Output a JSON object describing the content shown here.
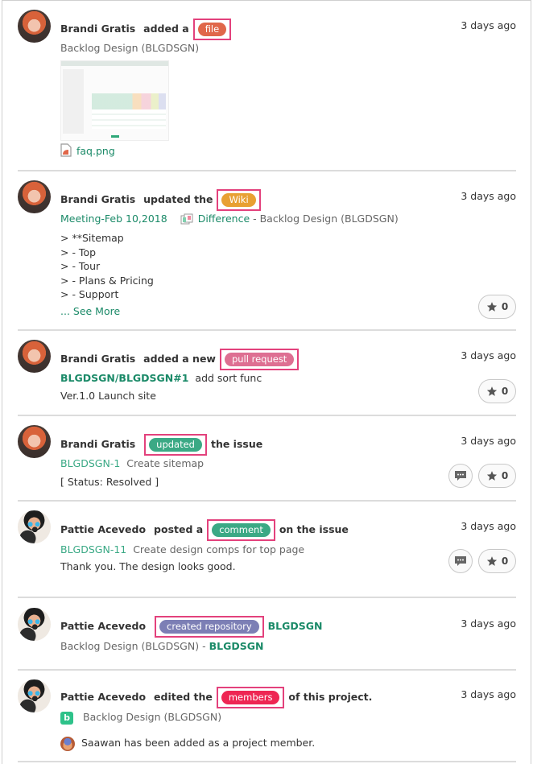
{
  "colors": {
    "file": "#e0674a",
    "wiki": "#e8a033",
    "pull_request": "#de6f92",
    "updated": "#3ba985",
    "comment": "#3ba985",
    "created_repository": "#7c7fb5",
    "members": "#ee2653",
    "highlight": "#e3417c",
    "link": "#1b8a68"
  },
  "activities": [
    {
      "user": "Brandi Gratis",
      "verb": "added a",
      "badge": "file",
      "time": "3 days ago",
      "project": "Backlog Design (BLGDSGN)",
      "attachment": {
        "icon": "image-file-icon",
        "name": "faq.png"
      }
    },
    {
      "user": "Brandi Gratis",
      "verb": "updated the",
      "badge": "Wiki",
      "time": "3 days ago",
      "page": "Meeting-Feb 10,2018",
      "diff_label": "Difference",
      "project_suffix": "- Backlog Design (BLGDSGN)",
      "lines": [
        "> **Sitemap",
        "> - Top",
        "> - Tour",
        "> - Plans & Pricing",
        "> - Support"
      ],
      "see_more": "... See More",
      "stars": "0"
    },
    {
      "user": "Brandi Gratis",
      "verb": "added a new",
      "badge": "pull request",
      "time": "3 days ago",
      "pr_link": "BLGDSGN/BLGDSGN#1",
      "pr_title": "add sort func",
      "detail": "Ver.1.0 Launch site",
      "stars": "0"
    },
    {
      "user": "Brandi Gratis",
      "badge": "updated",
      "verb_after": "the issue",
      "time": "3 days ago",
      "issue_key": "BLGDSGN-1",
      "issue_title": "Create sitemap",
      "detail": "[ Status: Resolved ]",
      "stars": "0"
    },
    {
      "user": "Pattie Acevedo",
      "verb": "posted a",
      "badge": "comment",
      "verb_after": "on the issue",
      "time": "3 days ago",
      "issue_key": "BLGDSGN-11",
      "issue_title": "Create design comps for top page",
      "detail": "Thank you. The design looks good.",
      "stars": "0"
    },
    {
      "user": "Pattie Acevedo",
      "badge": "created repository",
      "repo": "BLGDSGN",
      "time": "3 days ago",
      "project": "Backlog Design (BLGDSGN)",
      "project_sep": "-",
      "repo_link": "BLGDSGN"
    },
    {
      "user": "Pattie Acevedo",
      "verb": "edited the",
      "badge": "members",
      "verb_after": "of this project.",
      "time": "3 days ago",
      "project_icon_letter": "b",
      "project": "Backlog Design (BLGDSGN)",
      "detail": "Saawan has been added as a project member."
    }
  ]
}
